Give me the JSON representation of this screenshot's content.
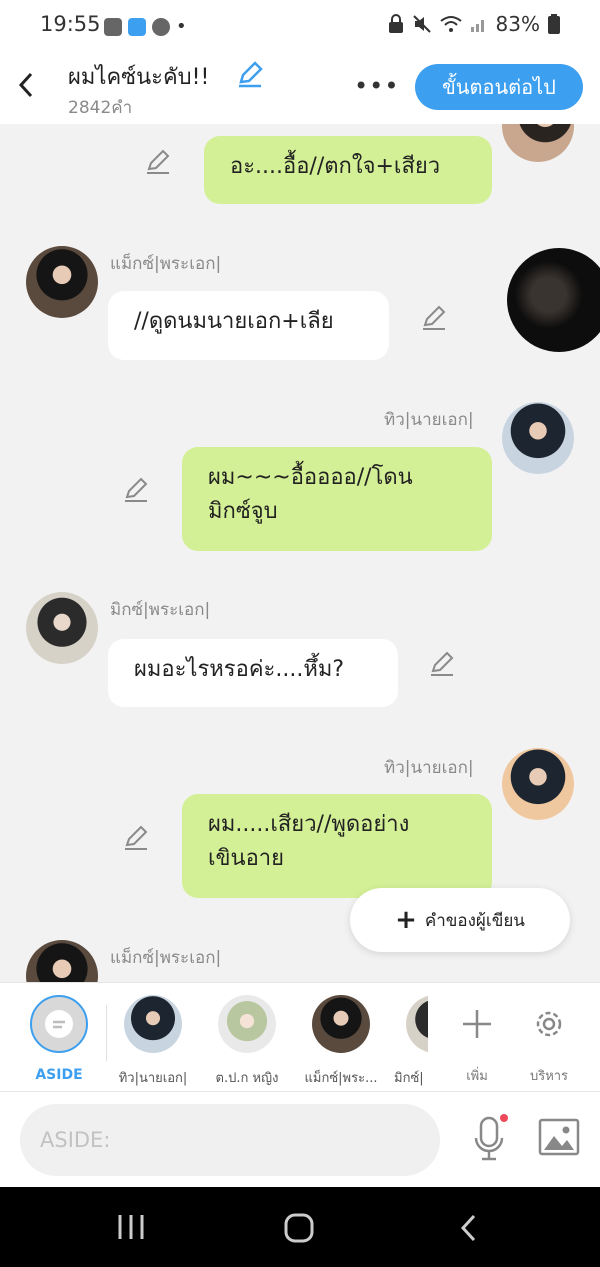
{
  "status_bar": {
    "time": "19:55",
    "battery": "83%"
  },
  "header": {
    "title": "ผมไคซ์นะคับ!!",
    "word_count": "2842คำ",
    "more": "•••",
    "next_button": "ขั้นตอนต่อไป"
  },
  "messages": [
    {
      "side": "right",
      "text": "อะ....อื้อ//ตกใจ+เสียว"
    },
    {
      "side": "left",
      "name": "แม็กซ์|พระเอก|",
      "text": "//ดูดนมนายเอก+เลีย"
    },
    {
      "side": "right",
      "name": "ทิว|นายเอก|",
      "text_lines": [
        "ผม~~~อื้ออออ//โดน",
        "มิกซ์จูบ"
      ]
    },
    {
      "side": "left",
      "name": "มิกซ์|พระเอก|",
      "text": "ผมอะไรหรอค่ะ....หึ้ม?"
    },
    {
      "side": "right",
      "name": "ทิว|นายเอก|",
      "text_lines": [
        "ผม.....เสียว//พูดอย่าง",
        "เขินอาย"
      ]
    },
    {
      "side": "left",
      "name": "แม็กซ์|พระเอก|"
    }
  ],
  "writer_note": {
    "plus": "+",
    "label": "คำของผู้เขียน"
  },
  "characters": [
    {
      "label": "ASIDE"
    },
    {
      "label": "ทิว|นายเอก|"
    },
    {
      "label": "ต.ป.ก หญิง"
    },
    {
      "label": "แม็กซ์|พระ..."
    },
    {
      "label": "มิกซ์|"
    }
  ],
  "tools": {
    "add_label": "เพิ่ม",
    "manage_label": "บริหาร"
  },
  "input": {
    "placeholder": "ASIDE:"
  },
  "colors": {
    "accent": "#3d9ff0",
    "green_bubble": "#d4f096",
    "background": "#f2f2f2"
  }
}
